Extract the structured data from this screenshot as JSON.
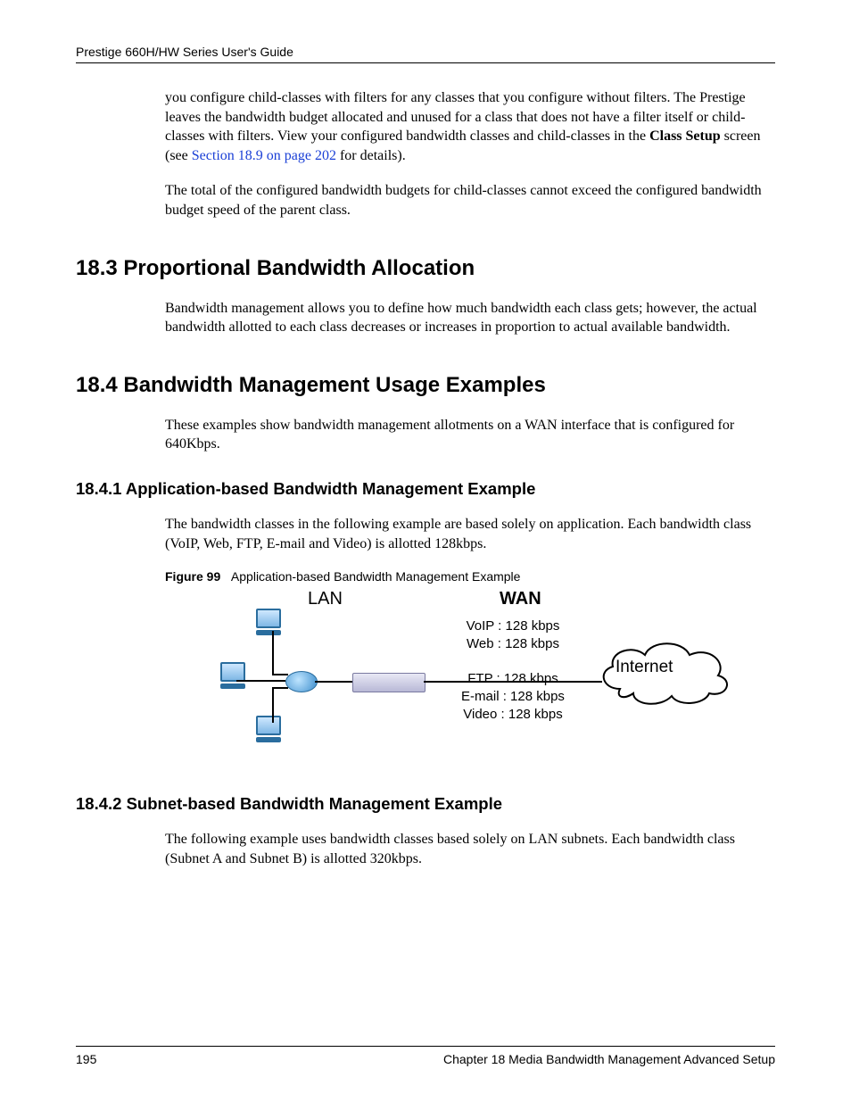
{
  "header": {
    "title": "Prestige 660H/HW Series User's Guide"
  },
  "intro": {
    "para1_a": "you configure child-classes with filters for any classes that you configure without filters. The Prestige leaves the bandwidth budget allocated and unused for a class that does not have a filter itself or child-classes with filters. View your configured bandwidth classes and child-classes in the ",
    "para1_bold": "Class Setup",
    "para1_b": " screen (see ",
    "para1_link": "Section 18.9 on page 202",
    "para1_c": " for details).",
    "para2": "The total of the configured bandwidth budgets for child-classes cannot exceed the configured bandwidth budget speed of the parent class."
  },
  "section_18_3": {
    "heading": "18.3  Proportional Bandwidth Allocation",
    "para": "Bandwidth management allows you to define how much bandwidth each class gets; however, the actual bandwidth allotted to each class decreases or increases in proportion to actual available bandwidth."
  },
  "section_18_4": {
    "heading": "18.4  Bandwidth Management Usage Examples",
    "para": "These examples show bandwidth management allotments on a WAN interface that is configured for 640Kbps."
  },
  "section_18_4_1": {
    "heading": "18.4.1  Application-based Bandwidth Management Example",
    "para": "The bandwidth classes in the following example are based solely on application. Each bandwidth class (VoIP, Web, FTP, E-mail and Video) is allotted 128kbps.",
    "figure_number": "Figure 99",
    "figure_title": "Application-based Bandwidth Management Example"
  },
  "diagram": {
    "lan": "LAN",
    "wan": "WAN",
    "internet": "Internet",
    "bw1": "VoIP : 128 kbps",
    "bw2": "Web : 128 kbps",
    "bw3": "FTP : 128 kbps",
    "bw4": "E-mail :  128 kbps",
    "bw5": "Video :  128 kbps"
  },
  "section_18_4_2": {
    "heading": "18.4.2  Subnet-based Bandwidth Management Example",
    "para": "The following example uses bandwidth classes based solely on LAN subnets. Each bandwidth class (Subnet A and Subnet B) is allotted 320kbps."
  },
  "footer": {
    "page": "195",
    "chapter": "Chapter 18 Media Bandwidth Management Advanced Setup"
  }
}
